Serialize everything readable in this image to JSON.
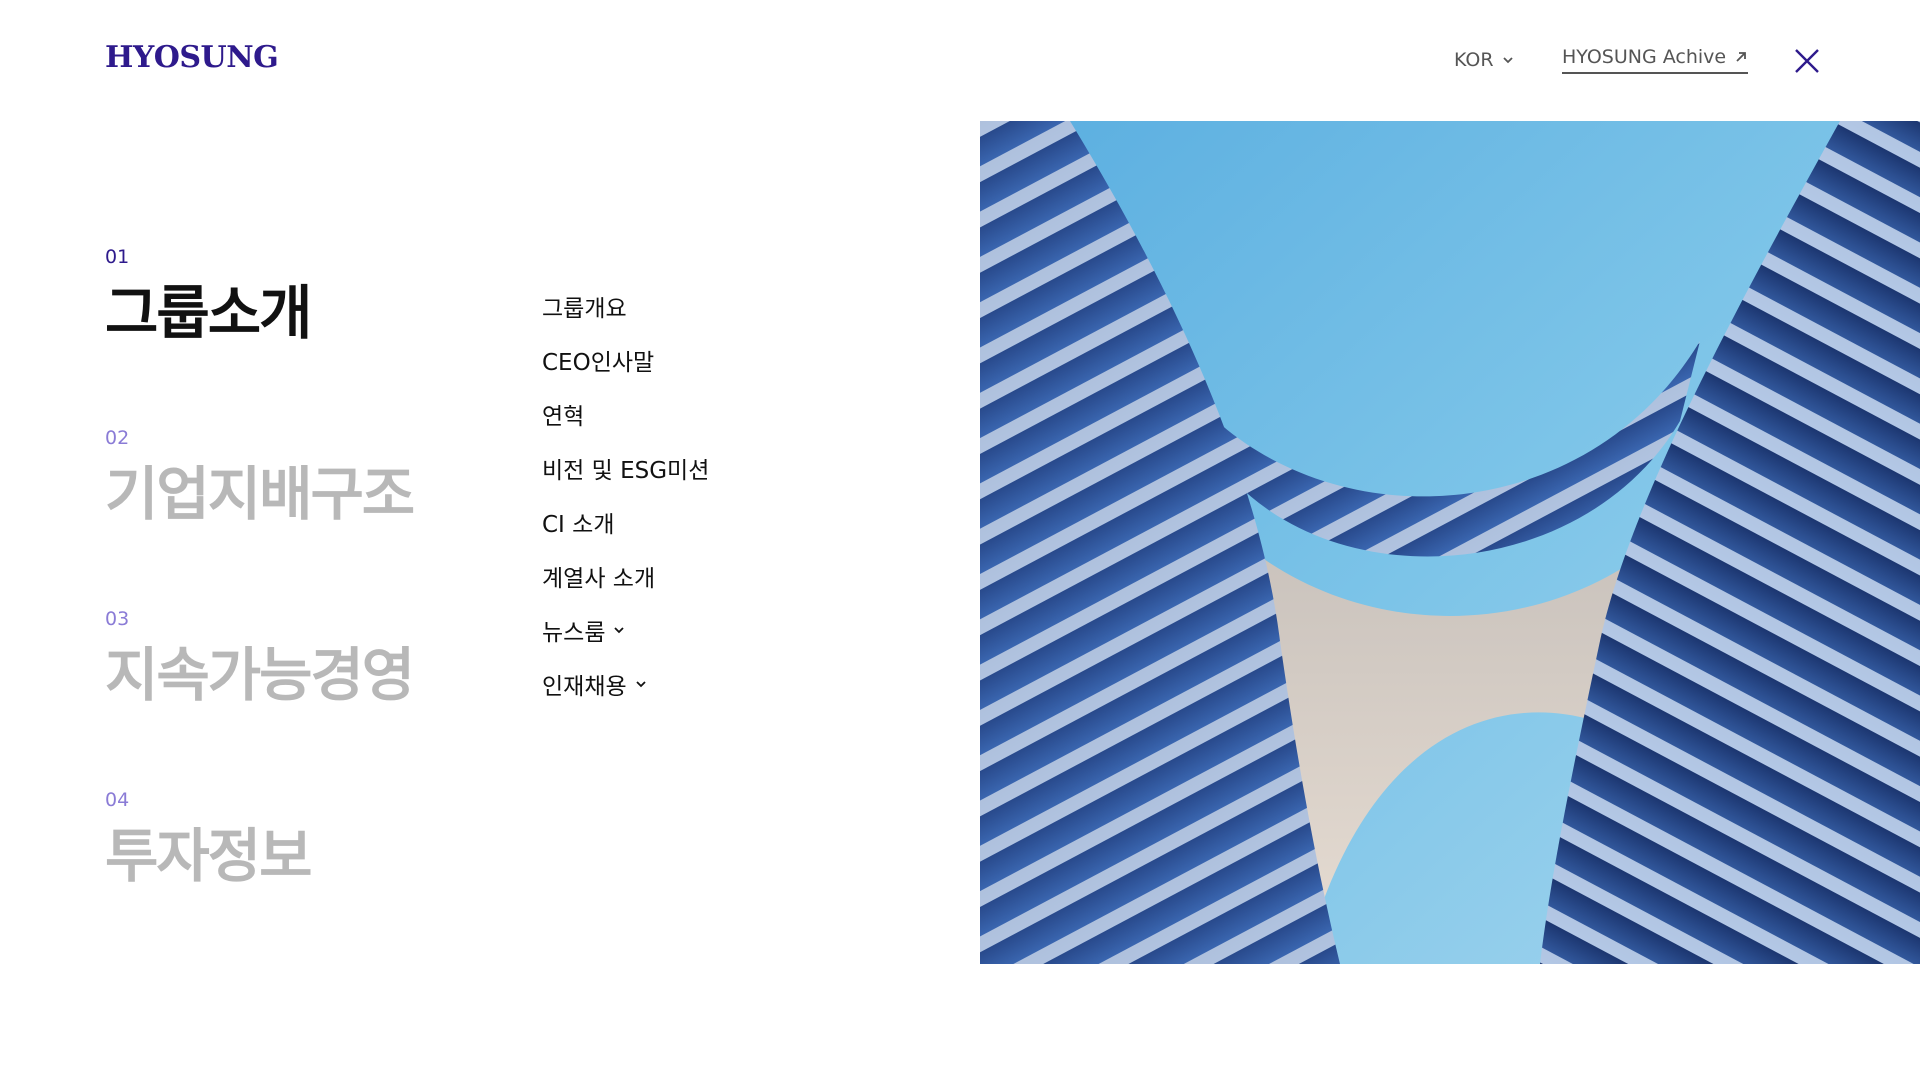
{
  "header": {
    "logo": "HYOSUNG",
    "language": "KOR",
    "archive_link": "HYOSUNG Achive"
  },
  "main_nav": [
    {
      "num": "01",
      "label": "그룹소개",
      "active": true
    },
    {
      "num": "02",
      "label": "기업지배구조",
      "active": false
    },
    {
      "num": "03",
      "label": "지속가능경영",
      "active": false
    },
    {
      "num": "04",
      "label": "투자정보",
      "active": false
    }
  ],
  "sub_nav": [
    {
      "label": "그룹개요",
      "has_dropdown": false
    },
    {
      "label": "CEO인사말",
      "has_dropdown": false
    },
    {
      "label": "연혁",
      "has_dropdown": false
    },
    {
      "label": "비전 및 ESG미션",
      "has_dropdown": false
    },
    {
      "label": "CI 소개",
      "has_dropdown": false
    },
    {
      "label": "계열사 소개",
      "has_dropdown": false
    },
    {
      "label": "뉴스룸",
      "has_dropdown": true
    },
    {
      "label": "인재채용",
      "has_dropdown": true
    }
  ],
  "icons": {
    "language_dropdown": "chevron-down-icon",
    "archive": "arrow-up-right-icon",
    "close": "close-icon",
    "submenu_dropdown": "chevron-down-icon"
  },
  "colors": {
    "brand": "#2e1a8c",
    "section_number": "#8a7bd6",
    "inactive_label": "#b8b8b8",
    "text": "#111111",
    "header_text": "#555555"
  }
}
